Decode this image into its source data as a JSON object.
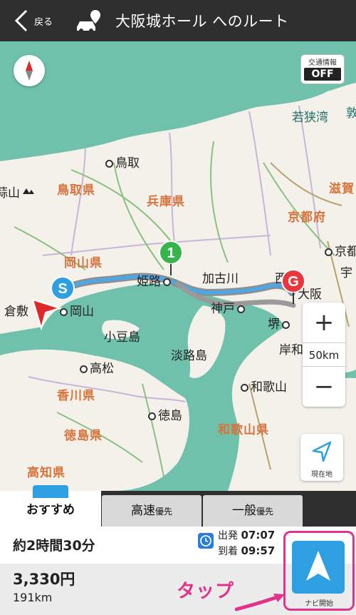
{
  "header": {
    "back_label": "戻る",
    "title": "大阪城ホール へのルート"
  },
  "map": {
    "traffic": {
      "label": "交通情報",
      "state": "OFF"
    },
    "zoom": {
      "plus": "+",
      "minus": "−",
      "scale": "50km"
    },
    "locate_label": "現在地",
    "markers": {
      "start": "S",
      "waypoint": "1",
      "goal": "G"
    },
    "places": [
      {
        "key": "tottori",
        "label": "鳥取"
      },
      {
        "key": "himeji",
        "label": "姫路"
      },
      {
        "key": "kakogawa",
        "label": "加古川"
      },
      {
        "key": "kobe",
        "label": "神戸"
      },
      {
        "key": "sakai",
        "label": "堺"
      },
      {
        "key": "okayama",
        "label": "岡山"
      },
      {
        "key": "kurashiki",
        "label": "倉敷"
      },
      {
        "key": "takamatsu",
        "label": "高松"
      },
      {
        "key": "tokushima",
        "label": "徳島"
      },
      {
        "key": "wakayama",
        "label": "和歌山"
      },
      {
        "key": "kyoto",
        "label": "京都"
      },
      {
        "key": "osaka_partial",
        "label": "大阪"
      },
      {
        "key": "kishiwada_partial",
        "label": "岸和"
      },
      {
        "key": "nishi_partial",
        "label": "西"
      },
      {
        "key": "uji_partial",
        "label": "宇"
      }
    ],
    "prefectures": [
      {
        "key": "tottori_pref",
        "label": "鳥取県"
      },
      {
        "key": "hyogo_pref",
        "label": "兵庫県"
      },
      {
        "key": "kyoto_pref",
        "label": "京都府"
      },
      {
        "key": "shiga_pref",
        "label": "滋賀"
      },
      {
        "key": "okayama_pref",
        "label": "岡山県"
      },
      {
        "key": "kagawa_pref",
        "label": "香川県"
      },
      {
        "key": "tokushima_pref",
        "label": "徳島県"
      },
      {
        "key": "kochi_pref",
        "label": "高知県"
      },
      {
        "key": "wakayama_pref",
        "label": "和歌山県"
      }
    ],
    "islands": [
      {
        "key": "shodoshima",
        "label": "小豆島"
      },
      {
        "key": "awajishima",
        "label": "淡路島"
      }
    ],
    "sea": [
      {
        "key": "wakasa_bay",
        "label": "若狭湾"
      },
      {
        "key": "edge_char",
        "label": "敦"
      }
    ],
    "partial_labels": [
      {
        "key": "mountain_partial",
        "label": "蒜山"
      }
    ]
  },
  "tabs": [
    {
      "label": "おすすめ",
      "suffix": ""
    },
    {
      "label": "高速",
      "suffix": "優先"
    },
    {
      "label": "一般",
      "suffix": "優先"
    }
  ],
  "route_summary": {
    "duration": "約2時間30分",
    "depart_label": "出発",
    "depart_time": "07:07",
    "arrive_label": "到着",
    "arrive_time": "09:57",
    "fare": "3,330円",
    "distance": "191km"
  },
  "annotation": {
    "tap_label": "タップ",
    "color": "#e2338b"
  },
  "navi_start_label": "ナビ開始",
  "colors": {
    "accent": "#2ea0e2",
    "sea": "#6fc1ab",
    "land": "#f3f1ea",
    "route": "#4aa8e8"
  }
}
